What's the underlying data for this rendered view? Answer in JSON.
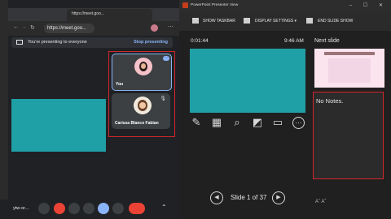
{
  "browser": {
    "tab_title": "https://meet.goo...",
    "address": "https://meet.goo...",
    "meeting_code": "ytw-or..."
  },
  "meet": {
    "banner_text": "You're presenting to everyone",
    "stop_label": "Stop presenting",
    "participants": [
      {
        "name": "You"
      },
      {
        "name": "Carissa Blanco Fabian"
      }
    ]
  },
  "presenter": {
    "window_title": "PowerPoint Presenter View",
    "toolbar": {
      "show_taskbar": "SHOW TASKBAR",
      "display_settings": "DISPLAY SETTINGS ▾",
      "end_slide_show": "END SLIDE SHOW"
    },
    "timer": "0:01:44",
    "clock": "9:46 AM",
    "next_slide_label": "Next slide",
    "notes_text": "No Notes.",
    "slide_counter": "Slide 1 of 37",
    "font_a": "Aˇ   Aˆ"
  },
  "colors": {
    "slide_teal": "#1fa0a6",
    "highlight_red": "#d3262c",
    "meet_accent": "#8ab4f8"
  }
}
